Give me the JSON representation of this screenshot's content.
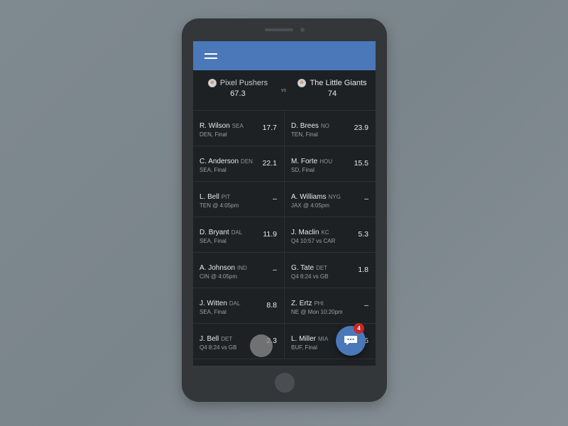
{
  "colors": {
    "accent": "#4a78b8",
    "badge": "#c62828",
    "screen_bg": "#1e2124",
    "phone_body": "#33373a"
  },
  "appbar": {
    "menu_icon": "hamburger-menu-icon"
  },
  "matchup": {
    "home": {
      "name": "Pixel Pushers",
      "score": "67.3"
    },
    "vs_label": "vs",
    "away": {
      "name": "The Little Giants",
      "score": "74"
    }
  },
  "rows": [
    {
      "left": {
        "name": "R. Wilson",
        "team": "SEA",
        "status": "DEN, Final",
        "points": "17.7"
      },
      "right": {
        "name": "D. Brees",
        "team": "NO",
        "status": "TEN, Final",
        "points": "23.9"
      }
    },
    {
      "left": {
        "name": "C. Anderson",
        "team": "DEN",
        "status": "SEA, Final",
        "points": "22.1"
      },
      "right": {
        "name": "M. Forte",
        "team": "HOU",
        "status": "SD, Final",
        "points": "15.5"
      }
    },
    {
      "left": {
        "name": "L. Bell",
        "team": "PIT",
        "status": "TEN @ 4:05pm",
        "points": "–"
      },
      "right": {
        "name": "A. Williams",
        "team": "NYG",
        "status": "JAX @ 4:05pm",
        "points": "–"
      }
    },
    {
      "left": {
        "name": "D. Bryant",
        "team": "DAL",
        "status": "SEA, Final",
        "points": "11.9"
      },
      "right": {
        "name": "J. Maclin",
        "team": "KC",
        "status": "Q4 10:57 vs CAR",
        "points": "5.3"
      }
    },
    {
      "left": {
        "name": "A. Johnson",
        "team": "IND",
        "status": "CIN @ 4:05pm",
        "points": "–"
      },
      "right": {
        "name": "G. Tate",
        "team": "DET",
        "status": "Q4 8:24 vs GB",
        "points": "1.8"
      }
    },
    {
      "left": {
        "name": "J. Witten",
        "team": "DAL",
        "status": "SEA, Final",
        "points": "8.8"
      },
      "right": {
        "name": "Z. Ertz",
        "team": "PHI",
        "status": "NE @ Mon 10:20pm",
        "points": "–"
      }
    },
    {
      "left": {
        "name": "J. Bell",
        "team": "DET",
        "status": "Q4 8:24 vs GB",
        "points": "2.3"
      },
      "right": {
        "name": "L. Miller",
        "team": "MIA",
        "status": "BUF, Final",
        "points": "5"
      }
    }
  ],
  "fab": {
    "icon": "chat-bubble-icon",
    "badge_count": "4"
  }
}
